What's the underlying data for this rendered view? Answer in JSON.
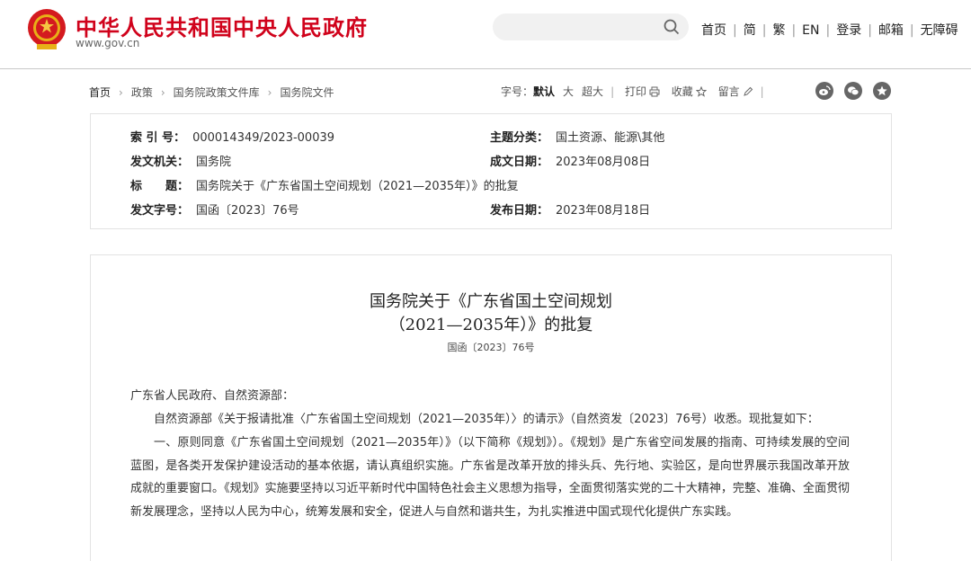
{
  "header": {
    "site_title": "中华人民共和国中央人民政府",
    "site_url": "www.gov.cn",
    "search_placeholder": "",
    "nav": [
      "首页",
      "简",
      "繁",
      "EN",
      "登录",
      "邮箱",
      "无障碍"
    ]
  },
  "breadcrumb": [
    "首页",
    "政策",
    "国务院政策文件库",
    "国务院文件"
  ],
  "toolbar": {
    "font_size_label": "字号：",
    "font_default": "默认",
    "font_large": "大",
    "font_xlarge": "超大",
    "print": "打印",
    "favorite": "收藏",
    "comment": "留言"
  },
  "metadata": {
    "index_label": "索 引 号：",
    "index_value": "000014349/2023-00039",
    "category_label": "主题分类：",
    "category_value": "国土资源、能源\\其他",
    "issuer_label": "发文机关：",
    "issuer_value": "国务院",
    "written_date_label": "成文日期：",
    "written_date_value": "2023年08月08日",
    "title_label": "标　　题：",
    "title_value": "国务院关于《广东省国土空间规划（2021—2035年）》的批复",
    "doc_number_label": "发文字号：",
    "doc_number_value": "国函〔2023〕76号",
    "publish_date_label": "发布日期：",
    "publish_date_value": "2023年08月18日"
  },
  "article": {
    "title_line1": "国务院关于《广东省国土空间规划",
    "title_line2": "（2021—2035年）》的批复",
    "doc_number": "国函〔2023〕76号",
    "addressee": "广东省人民政府、自然资源部：",
    "para1": "自然资源部《关于报请批准〈广东省国土空间规划（2021—2035年）〉的请示》（自然资发〔2023〕76号）收悉。现批复如下：",
    "para2": "一、原则同意《广东省国土空间规划（2021—2035年）》（以下简称《规划》）。《规划》是广东省空间发展的指南、可持续发展的空间蓝图，是各类开发保护建设活动的基本依据，请认真组织实施。广东省是改革开放的排头兵、先行地、实验区，是向世界展示我国改革开放成就的重要窗口。《规划》实施要坚持以习近平新时代中国特色社会主义思想为指导，全面贯彻落实党的二十大精神，完整、准确、全面贯彻新发展理念，坚持以人民为中心，统筹发展和安全，促进人与自然和谐共生，为扎实推进中国式现代化提供广东实践。"
  },
  "colors": {
    "brand_red": "#d0021b",
    "border": "#e3e3e3"
  },
  "icons": [
    "national-emblem-icon",
    "search-icon",
    "print-icon",
    "star-icon",
    "pencil-icon",
    "weibo-icon",
    "wechat-icon",
    "favorite-star-icon"
  ]
}
